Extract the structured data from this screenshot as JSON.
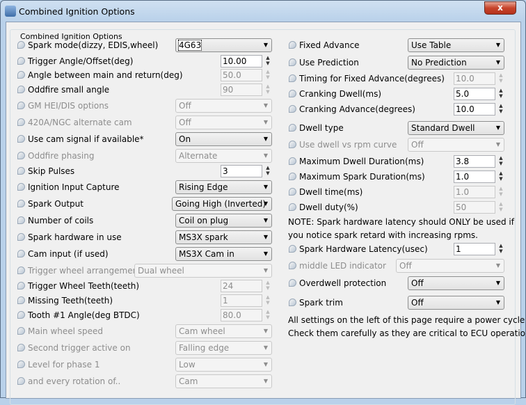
{
  "window": {
    "title": "Combined Ignition Options",
    "close_label": "x"
  },
  "group_title": "Combined Ignition Options",
  "left": [
    {
      "label": "Spark mode(dizzy, EDIS,wheel)",
      "type": "combo",
      "value": "4G63",
      "enabled": true,
      "label_enabled": true
    },
    {
      "label": "Trigger Angle/Offset(deg)",
      "type": "spin",
      "value": "10.00",
      "enabled": true,
      "label_enabled": true
    },
    {
      "label": "Angle between main and return(deg)",
      "type": "spin",
      "value": "50.0",
      "enabled": false,
      "label_enabled": true
    },
    {
      "label": "Oddfire small angle",
      "type": "spin",
      "value": "90",
      "enabled": false,
      "label_enabled": true
    },
    {
      "label": "GM HEI/DIS options",
      "type": "combo",
      "value": "Off",
      "enabled": false,
      "label_enabled": false
    },
    {
      "label": "420A/NGC alternate cam",
      "type": "combo",
      "value": "Off",
      "enabled": false,
      "label_enabled": false
    },
    {
      "label": "Use cam signal if available*",
      "type": "combo",
      "value": "On",
      "enabled": true,
      "label_enabled": true
    },
    {
      "label": "Oddfire phasing",
      "type": "combo",
      "value": "Alternate",
      "enabled": false,
      "label_enabled": false
    },
    {
      "label": "Skip Pulses",
      "type": "spin",
      "value": "3",
      "enabled": true,
      "label_enabled": true
    },
    {
      "label": "Ignition Input Capture",
      "type": "combo",
      "value": "Rising Edge",
      "enabled": true,
      "label_enabled": true
    },
    {
      "label": "Spark Output",
      "type": "combo",
      "value": "Going High (Inverted)",
      "enabled": true,
      "label_enabled": true
    },
    {
      "label": "Number of coils",
      "type": "combo",
      "value": "Coil on plug",
      "enabled": true,
      "label_enabled": true
    },
    {
      "label": "Spark hardware in use",
      "type": "combo",
      "value": "MS3X spark",
      "enabled": true,
      "label_enabled": true
    },
    {
      "label": "Cam input (if used)",
      "type": "combo",
      "value": "MS3X Cam in",
      "enabled": true,
      "label_enabled": true
    },
    {
      "label": "Trigger wheel arrangement",
      "type": "combo",
      "value": "Dual wheel",
      "enabled": false,
      "label_enabled": false
    },
    {
      "label": "Trigger Wheel Teeth(teeth)",
      "type": "spin",
      "value": "24",
      "enabled": false,
      "label_enabled": true
    },
    {
      "label": "Missing Teeth(teeth)",
      "type": "spin",
      "value": "1",
      "enabled": false,
      "label_enabled": true
    },
    {
      "label": "Tooth #1 Angle(deg BTDC)",
      "type": "spin",
      "value": "80.0",
      "enabled": false,
      "label_enabled": true
    },
    {
      "label": "Main wheel speed",
      "type": "combo",
      "value": "Cam wheel",
      "enabled": false,
      "label_enabled": false
    },
    {
      "label": "Second trigger active on",
      "type": "combo",
      "value": "Falling edge",
      "enabled": false,
      "label_enabled": false
    },
    {
      "label": "Level for phase 1",
      "type": "combo",
      "value": "Low",
      "enabled": false,
      "label_enabled": false
    },
    {
      "label": "and every rotation of..",
      "type": "combo",
      "value": "Cam",
      "enabled": false,
      "label_enabled": false
    }
  ],
  "right": [
    {
      "label": "Fixed Advance",
      "type": "combo",
      "value": "Use Table",
      "enabled": true,
      "label_enabled": true
    },
    {
      "label": "Use Prediction",
      "type": "combo",
      "value": "No Prediction",
      "enabled": true,
      "label_enabled": true
    },
    {
      "label": "Timing for Fixed Advance(degrees)",
      "type": "spin",
      "value": "10.0",
      "enabled": false,
      "label_enabled": true
    },
    {
      "label": "Cranking Dwell(ms)",
      "type": "spin",
      "value": "5.0",
      "enabled": true,
      "label_enabled": true
    },
    {
      "label": "Cranking Advance(degrees)",
      "type": "spin",
      "value": "10.0",
      "enabled": true,
      "label_enabled": true
    },
    {
      "label": "Dwell type",
      "type": "combo",
      "value": "Standard Dwell",
      "enabled": true,
      "label_enabled": true
    },
    {
      "label": "Use dwell vs rpm curve",
      "type": "combo",
      "value": "Off",
      "enabled": false,
      "label_enabled": false
    },
    {
      "label": "Maximum Dwell Duration(ms)",
      "type": "spin",
      "value": "3.8",
      "enabled": true,
      "label_enabled": true
    },
    {
      "label": "Maximum Spark Duration(ms)",
      "type": "spin",
      "value": "1.0",
      "enabled": true,
      "label_enabled": true
    },
    {
      "label": "Dwell time(ms)",
      "type": "spin",
      "value": "1.0",
      "enabled": false,
      "label_enabled": true
    },
    {
      "label": "Dwell duty(%)",
      "type": "spin",
      "value": "50",
      "enabled": false,
      "label_enabled": true
    },
    {
      "label": "Spark Hardware Latency(usec)",
      "type": "spin",
      "value": "1",
      "enabled": true,
      "label_enabled": true
    },
    {
      "label": "middle LED indicator",
      "type": "combo",
      "value": "Off",
      "enabled": false,
      "label_enabled": false
    },
    {
      "label": "Overdwell protection",
      "type": "combo",
      "value": "Off",
      "enabled": true,
      "label_enabled": true
    },
    {
      "label": "Spark trim",
      "type": "combo",
      "value": "Off",
      "enabled": true,
      "label_enabled": true
    }
  ],
  "notes": {
    "latency_line1": "NOTE: Spark hardware latency should ONLY be used if",
    "latency_line2": "you notice spark retard with increasing rpms.",
    "footer_line1": "All settings on the left of this page require a power cycle",
    "footer_line2": "Check them carefully as they are critical to ECU operation"
  }
}
